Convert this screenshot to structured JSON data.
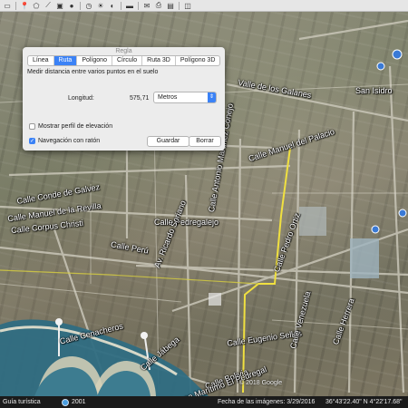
{
  "toolbar": {
    "icons": [
      "sidebar-icon",
      "placemark-icon",
      "polygon-icon",
      "path-icon",
      "overlay-icon",
      "tour-icon",
      "history-icon",
      "sun-icon",
      "planets-icon",
      "ruler-icon",
      "email-icon",
      "print-icon",
      "save-image-icon",
      "maps-icon"
    ]
  },
  "dialog": {
    "title": "Regla",
    "tabs": [
      "Línea",
      "Ruta",
      "Polígono",
      "Círculo",
      "Ruta 3D",
      "Polígono 3D"
    ],
    "active_tab": "Ruta",
    "subtitle": "Medir distancia entre varios puntos en el suelo",
    "length_label": "Longitud:",
    "length_value": "575,71",
    "unit": "Metros",
    "elevation_profile_label": "Mostrar perfil de elevación",
    "elevation_profile_checked": false,
    "mouse_nav_label": "Navegación con ratón",
    "mouse_nav_checked": true,
    "save_label": "Guardar",
    "clear_label": "Borrar"
  },
  "map": {
    "streets": [
      "Calle Manuel del Palacio",
      "Calle Conde de Galvez",
      "Calle Manuel de la Revilla",
      "Calle Corpus Christi",
      "Calle Pedregalejo",
      "Calle Antonio Martínez Conejo",
      "Av. Ricardo Soriano",
      "Calle Perú",
      "Calle Eugenio Sellés",
      "Calle Cenacheros",
      "Calle Jábega",
      "Calle Bolivia",
      "Paseo Marítimo El Pedregal",
      "Calle Herrera",
      "Calle Venezuela",
      "Valle de los Galanes",
      "San Isidro",
      "Calle Pedro Ortiz"
    ],
    "copyright": "© 2018 Google",
    "path_color": "#f0e040"
  },
  "statusbar": {
    "tour_guide": "Guía turística",
    "year": "2001",
    "image_date": "Fecha de las imágenes: 3/29/2016",
    "coords": "36°43'22.40\" N    4°22'17.68\""
  }
}
